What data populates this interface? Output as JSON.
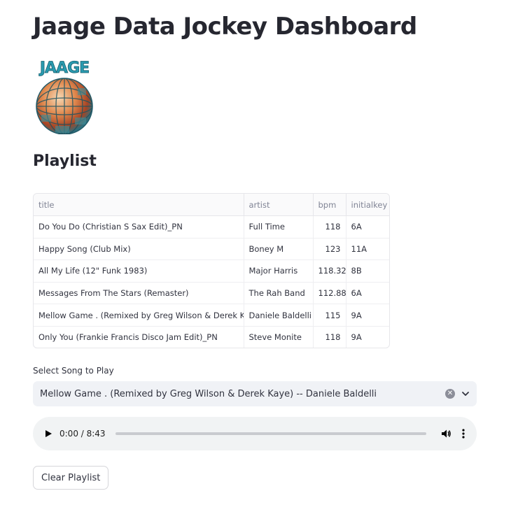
{
  "header": {
    "title": "Jaage Data Jockey Dashboard"
  },
  "logo": {
    "text": "JAAGE"
  },
  "playlist": {
    "title": "Playlist",
    "columns": [
      "title",
      "artist",
      "bpm",
      "initialkey"
    ],
    "rows": [
      {
        "title": "Do You Do (Christian S Sax Edit)_PN",
        "artist": "Full Time",
        "bpm": "118",
        "initialkey": "6A"
      },
      {
        "title": "Happy Song (Club Mix)",
        "artist": "Boney M",
        "bpm": "123",
        "initialkey": "11A"
      },
      {
        "title": "All My Life (12\" Funk 1983)",
        "artist": "Major Harris",
        "bpm": "118.32",
        "initialkey": "8B"
      },
      {
        "title": "Messages From The Stars (Remaster)",
        "artist": "The Rah Band",
        "bpm": "112.88",
        "initialkey": "6A"
      },
      {
        "title": "Mellow Game . (Remixed by Greg Wilson & Derek Kaye)",
        "artist": "Daniele Baldelli",
        "bpm": "115",
        "initialkey": "9A"
      },
      {
        "title": "Only You (Frankie Francis Disco Jam Edit)_PN",
        "artist": "Steve Monite",
        "bpm": "118",
        "initialkey": "9A"
      }
    ]
  },
  "song_select": {
    "label": "Select Song to Play",
    "value": "Mellow Game . (Remixed by Greg Wilson & Derek Kaye) -- Daniele Baldelli"
  },
  "player": {
    "time": "0:00 / 8:43",
    "progress": 0
  },
  "buttons": {
    "clear_playlist": "Clear Playlist"
  }
}
